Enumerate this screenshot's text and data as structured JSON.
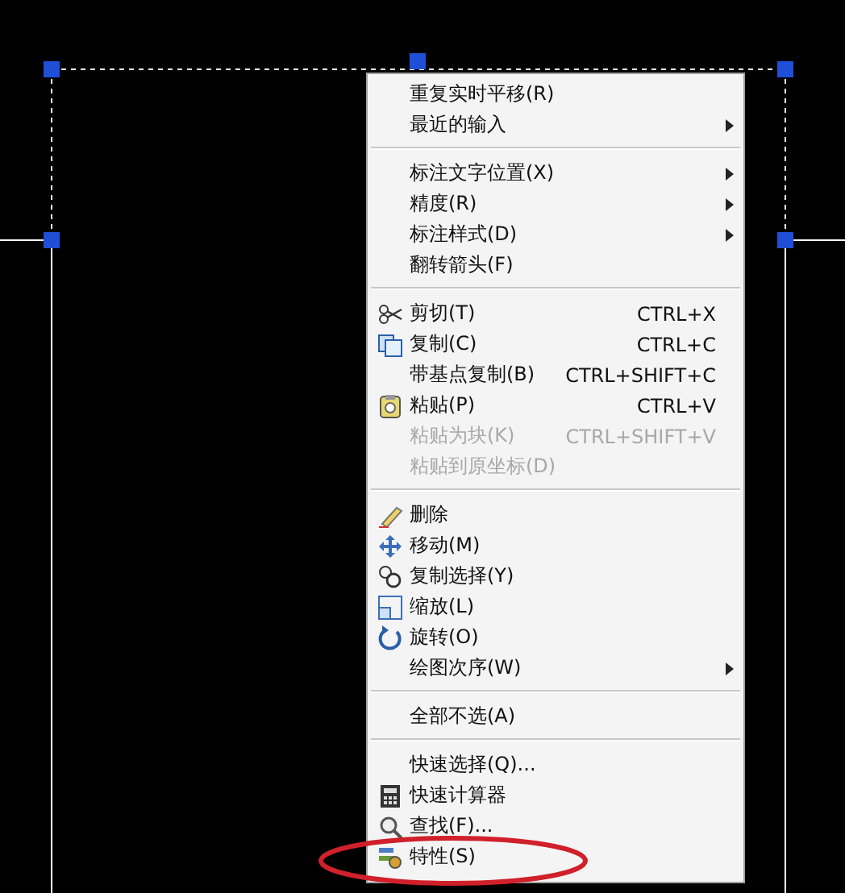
{
  "context_menu": {
    "items": [
      {
        "kind": "item",
        "label": "重复实时平移(R)",
        "disabled": false,
        "submenu": false
      },
      {
        "kind": "item",
        "label": "最近的输入",
        "disabled": false,
        "submenu": true
      },
      {
        "kind": "separator"
      },
      {
        "kind": "item",
        "label": "标注文字位置(X)",
        "disabled": false,
        "submenu": true
      },
      {
        "kind": "item",
        "label": "精度(R)",
        "disabled": false,
        "submenu": true
      },
      {
        "kind": "item",
        "label": "标注样式(D)",
        "disabled": false,
        "submenu": true
      },
      {
        "kind": "item",
        "label": "翻转箭头(F)",
        "disabled": false,
        "submenu": false
      },
      {
        "kind": "separator"
      },
      {
        "kind": "item",
        "label": "剪切(T)",
        "shortcut": "CTRL+X",
        "disabled": false,
        "submenu": false
      },
      {
        "kind": "item",
        "label": "复制(C)",
        "shortcut": "CTRL+C",
        "disabled": false,
        "submenu": false
      },
      {
        "kind": "item",
        "label": "带基点复制(B)",
        "shortcut": "CTRL+SHIFT+C",
        "disabled": false,
        "submenu": false
      },
      {
        "kind": "item",
        "label": "粘贴(P)",
        "shortcut": "CTRL+V",
        "disabled": false,
        "submenu": false
      },
      {
        "kind": "item",
        "label": "粘贴为块(K)",
        "shortcut": "CTRL+SHIFT+V",
        "disabled": true,
        "submenu": false
      },
      {
        "kind": "item",
        "label": "粘贴到原坐标(D)",
        "disabled": true,
        "submenu": false
      },
      {
        "kind": "separator"
      },
      {
        "kind": "item",
        "label": "删除",
        "disabled": false,
        "submenu": false
      },
      {
        "kind": "item",
        "label": "移动(M)",
        "disabled": false,
        "submenu": false
      },
      {
        "kind": "item",
        "label": "复制选择(Y)",
        "disabled": false,
        "submenu": false
      },
      {
        "kind": "item",
        "label": "缩放(L)",
        "disabled": false,
        "submenu": false
      },
      {
        "kind": "item",
        "label": "旋转(O)",
        "disabled": false,
        "submenu": false
      },
      {
        "kind": "item",
        "label": "绘图次序(W)",
        "disabled": false,
        "submenu": true
      },
      {
        "kind": "separator"
      },
      {
        "kind": "item",
        "label": "全部不选(A)",
        "disabled": false,
        "submenu": false
      },
      {
        "kind": "separator"
      },
      {
        "kind": "item",
        "label": "快速选择(Q)...",
        "disabled": false,
        "submenu": false
      },
      {
        "kind": "item",
        "label": "快速计算器",
        "disabled": false,
        "submenu": false
      },
      {
        "kind": "item",
        "label": "查找(F)...",
        "disabled": false,
        "submenu": false
      },
      {
        "kind": "item",
        "label": "特性(S)",
        "disabled": false,
        "submenu": false
      }
    ]
  }
}
